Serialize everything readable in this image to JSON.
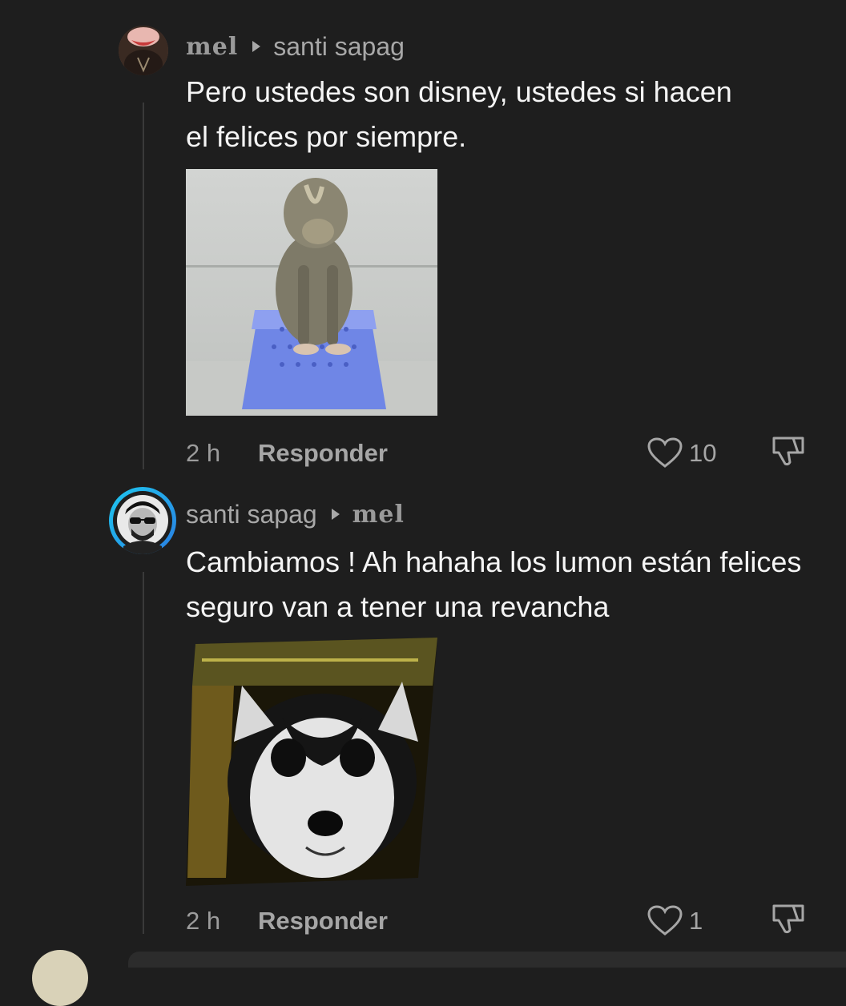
{
  "comments": [
    {
      "author": "mel",
      "reply_to": "santi sapag",
      "text": "Pero ustedes son disney, ustedes si hacen el felices por siempre.",
      "time": "2 h",
      "reply_label": "Responder",
      "likes": "10"
    },
    {
      "author": "santi sapag",
      "reply_to": "mel",
      "text": "Cambiamos ! Ah hahaha los lumon están felices seguro van a tener una revancha",
      "time": "2 h",
      "reply_label": "Responder",
      "likes": "1"
    }
  ],
  "icons": {
    "like": "heart-icon",
    "dislike": "thumbs-down-icon",
    "separator": "caret-right-icon"
  },
  "colors": {
    "background": "#1e1e1e",
    "story_ring_start": "#1ec8f0",
    "story_ring_end": "#2a7de1"
  }
}
